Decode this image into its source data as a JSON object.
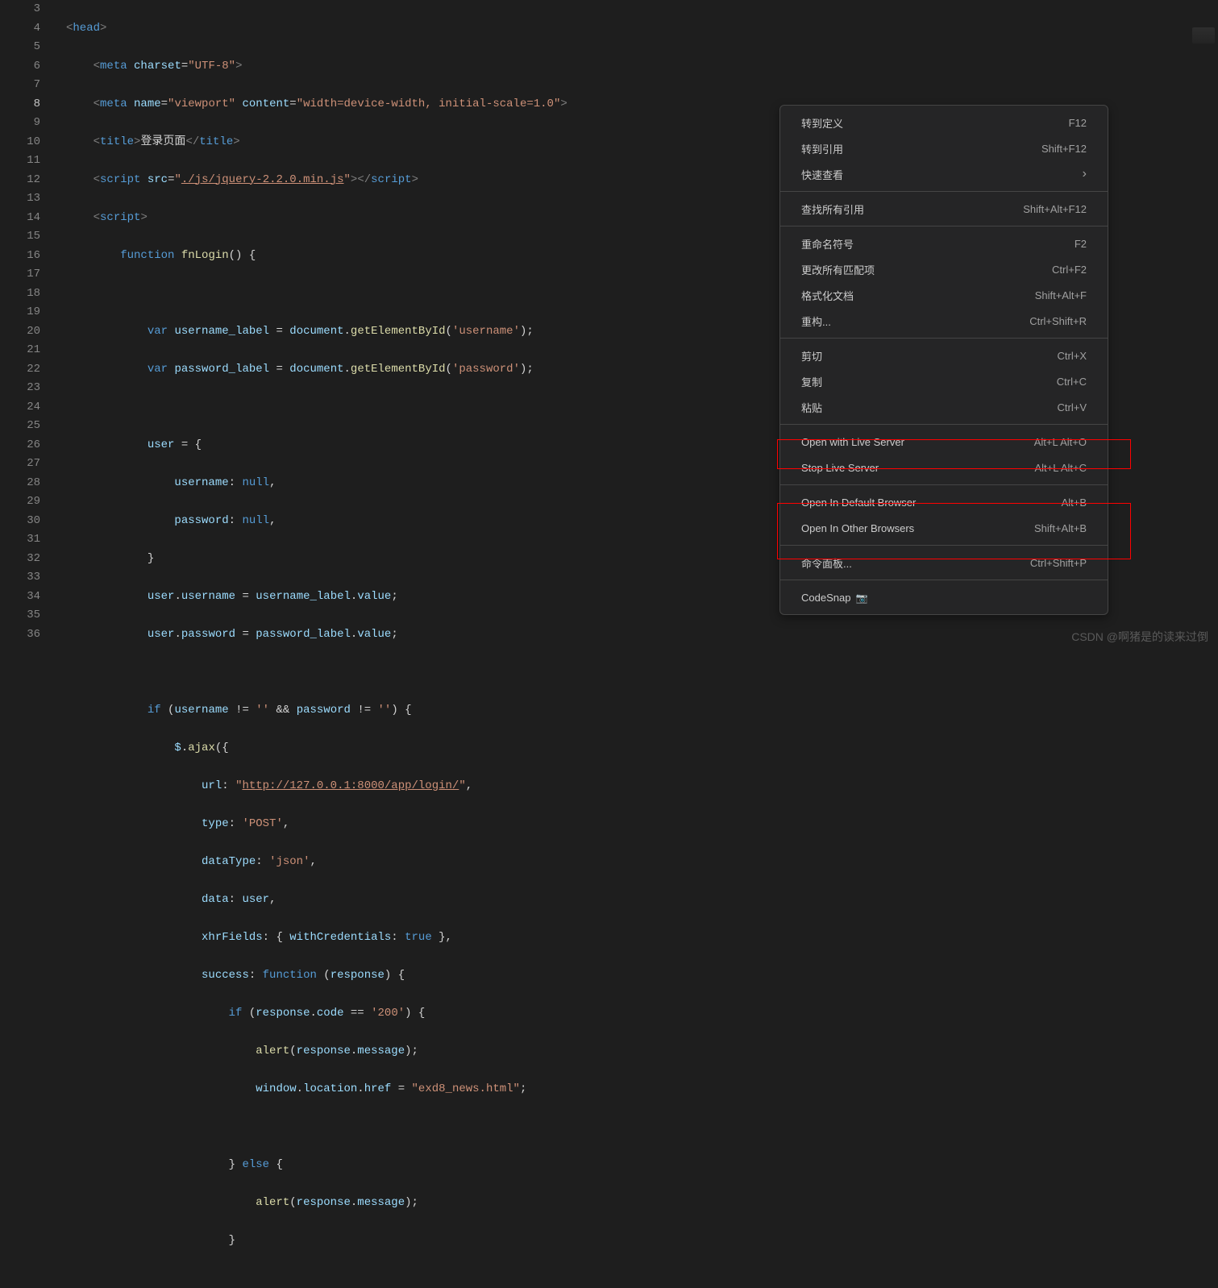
{
  "gutter": {
    "start": 3,
    "end": 36,
    "current": 8
  },
  "code": {
    "l3": {
      "tag_open": "<",
      "tag": "head",
      "tag_close": ">"
    },
    "l4": {
      "tag_open": "<",
      "tag": "meta",
      "sp": " ",
      "attr": "charset",
      "eq": "=",
      "q1": "\"",
      "val": "UTF-8",
      "q2": "\"",
      "tag_close": ">"
    },
    "l5": {
      "tag_open": "<",
      "tag": "meta",
      "sp": " ",
      "attr1": "name",
      "eq": "=",
      "q": "\"",
      "val1": "viewport",
      "attr2": "content",
      "val2": "width=device-width, initial-scale=1.0",
      "tag_close": ">"
    },
    "l6": {
      "tag_open": "<",
      "tag": "title",
      "tag_close": ">",
      "text": "登录页面",
      "ctag_open": "</",
      "ctag": "title",
      "ctag_close": ">"
    },
    "l7": {
      "tag_open": "<",
      "tag": "script",
      "sp": " ",
      "attr": "src",
      "eq": "=",
      "q": "\"",
      "val": "./js/jquery-2.2.0.min.js",
      "tag_close": ">",
      "ctag_open": "</",
      "ctag": "script",
      "ctag_close": ">"
    },
    "l8": {
      "tag_open": "<",
      "tag": "script",
      "tag_close": ">"
    },
    "l9": {
      "kw": "function",
      "fn": "fnLogin",
      "paren": "() {"
    },
    "l11": {
      "kw": "var",
      "var": "username_label",
      "eq": " = ",
      "obj": "document",
      "dot": ".",
      "fn": "getElementById",
      "p1": "(",
      "str": "'username'",
      "p2": ");"
    },
    "l12": {
      "kw": "var",
      "var": "password_label",
      "eq": " = ",
      "obj": "document",
      "dot": ".",
      "fn": "getElementById",
      "p1": "(",
      "str": "'password'",
      "p2": ");"
    },
    "l14": {
      "var": "user",
      "rest": " = {"
    },
    "l15": {
      "prop": "username",
      "rest": ": ",
      "kw": "null",
      "c": ","
    },
    "l16": {
      "prop": "password",
      "rest": ": ",
      "kw": "null",
      "c": ","
    },
    "l17": {
      "txt": "}"
    },
    "l18": {
      "var1": "user",
      "d": ".",
      "var2": "username",
      "eq": " = ",
      "var3": "username_label",
      "d2": ".",
      "var4": "value",
      "sc": ";"
    },
    "l19": {
      "var1": "user",
      "d": ".",
      "var2": "password",
      "eq": " = ",
      "var3": "password_label",
      "d2": ".",
      "var4": "value",
      "sc": ";"
    },
    "l21": {
      "kw": "if",
      "p": " (",
      "v1": "username",
      "op": " != ",
      "s1": "''",
      "and": " && ",
      "v2": "password",
      "op2": " != ",
      "s2": "''",
      "p2": ") {"
    },
    "l22": {
      "jq": "$",
      "d": ".",
      "fn": "ajax",
      "p": "({"
    },
    "l23": {
      "prop": "url",
      "c": ": ",
      "q": "\"",
      "val": "http://127.0.0.1:8000/app/login/",
      "q2": "\"",
      "cm": ","
    },
    "l24": {
      "prop": "type",
      "c": ": ",
      "val": "'POST'",
      "cm": ","
    },
    "l25": {
      "prop": "dataType",
      "c": ": ",
      "val": "'json'",
      "cm": ","
    },
    "l26": {
      "prop": "data",
      "c": ": ",
      "var": "user",
      "cm": ","
    },
    "l27": {
      "prop": "xhrFields",
      "c": ": { ",
      "p2": "withCredentials",
      "c2": ": ",
      "kw": "true",
      "end": " },"
    },
    "l28": {
      "prop": "success",
      "c": ": ",
      "kw": "function",
      "p": " (",
      "arg": "response",
      "p2": ") {"
    },
    "l29": {
      "kw": "if",
      "p": " (",
      "v": "response",
      "d": ".",
      "v2": "code",
      "op": " == ",
      "s": "'200'",
      "p2": ") {"
    },
    "l30": {
      "fn": "alert",
      "p": "(",
      "v": "response",
      "d": ".",
      "v2": "message",
      "p2": ");"
    },
    "l31": {
      "v": "window",
      "d": ".",
      "v2": "location",
      "d2": ".",
      "v3": "href",
      "eq": " = ",
      "s": "\"exd8_news.html\"",
      "sc": ";"
    },
    "l33": {
      "b": "} ",
      "kw": "else",
      "b2": " {"
    },
    "l34": {
      "fn": "alert",
      "p": "(",
      "v": "response",
      "d": ".",
      "v2": "message",
      "p2": ");"
    },
    "l35": {
      "b": "}"
    }
  },
  "menu": {
    "groups": [
      [
        {
          "label": "转到定义",
          "shortcut": "F12"
        },
        {
          "label": "转到引用",
          "shortcut": "Shift+F12"
        },
        {
          "label": "快速查看",
          "shortcut": "",
          "chevron": true
        }
      ],
      [
        {
          "label": "查找所有引用",
          "shortcut": "Shift+Alt+F12"
        }
      ],
      [
        {
          "label": "重命名符号",
          "shortcut": "F2"
        },
        {
          "label": "更改所有匹配项",
          "shortcut": "Ctrl+F2"
        },
        {
          "label": "格式化文档",
          "shortcut": "Shift+Alt+F"
        },
        {
          "label": "重构...",
          "shortcut": "Ctrl+Shift+R"
        }
      ],
      [
        {
          "label": "剪切",
          "shortcut": "Ctrl+X"
        },
        {
          "label": "复制",
          "shortcut": "Ctrl+C"
        },
        {
          "label": "粘贴",
          "shortcut": "Ctrl+V"
        }
      ],
      [
        {
          "label": "Open with Live Server",
          "shortcut": "Alt+L Alt+O"
        },
        {
          "label": "Stop Live Server",
          "shortcut": "Alt+L Alt+C"
        }
      ],
      [
        {
          "label": "Open In Default Browser",
          "shortcut": "Alt+B"
        },
        {
          "label": "Open In Other Browsers",
          "shortcut": "Shift+Alt+B"
        }
      ],
      [
        {
          "label": "命令面板...",
          "shortcut": "Ctrl+Shift+P"
        }
      ],
      [
        {
          "label": "CodeSnap",
          "shortcut": "",
          "camera": true
        }
      ]
    ]
  },
  "watermark": "CSDN @啊猪是的读来过倒"
}
